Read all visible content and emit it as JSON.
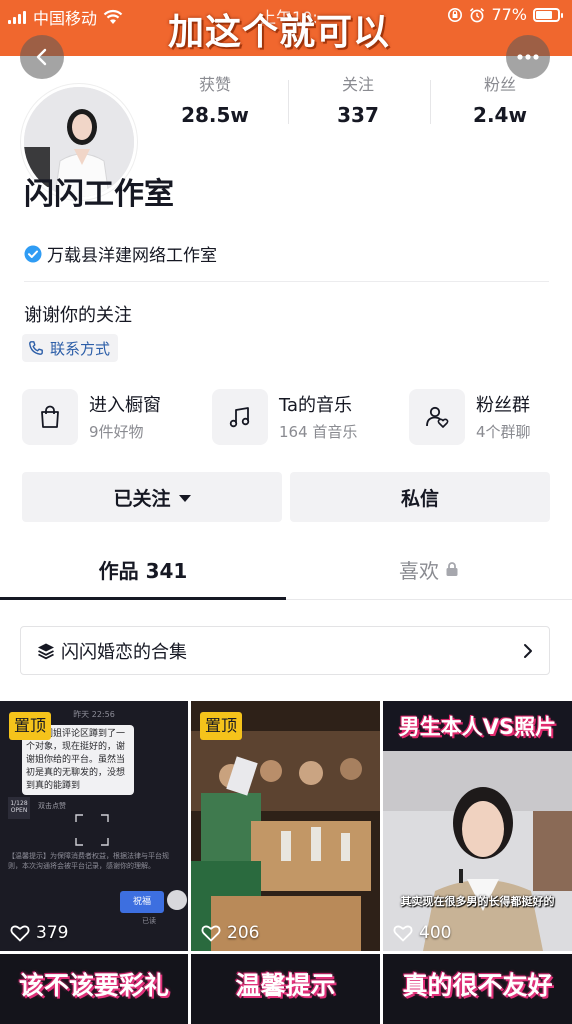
{
  "overlay_caption": "加这个就可以",
  "status_bar": {
    "carrier": "中国移动",
    "clock_partial": "上午10:",
    "battery_percent": "77%",
    "battery_level": 0.77
  },
  "profile": {
    "stats": [
      {
        "label": "获赞",
        "value": "28.5w"
      },
      {
        "label": "关注",
        "value": "337"
      },
      {
        "label": "粉丝",
        "value": "2.4w"
      }
    ],
    "nickname": "闪闪工作室",
    "verification": "万载县洋建网络工作室",
    "bio": "谢谢你的关注",
    "contact_label": "联系方式"
  },
  "features": [
    {
      "icon": "shopping-bag-icon",
      "title": "进入橱窗",
      "subtitle": "9件好物"
    },
    {
      "icon": "music-note-icon",
      "title": "Ta的音乐",
      "subtitle": "164 首音乐"
    },
    {
      "icon": "fan-group-icon",
      "title": "粉丝群",
      "subtitle": "4个群聊"
    }
  ],
  "actions": {
    "followed_label": "已关注",
    "message_label": "私信"
  },
  "tabs": {
    "works_label": "作品 341",
    "likes_label": "喜欢"
  },
  "collection": {
    "label": "闪闪婚恋的合集"
  },
  "videos": [
    {
      "pinned_label": "置顶",
      "likes": "379"
    },
    {
      "pinned_label": "置顶",
      "likes": "206"
    },
    {
      "title": "男生本人VS照片",
      "caption": "其实现在很多男的长得都挺好的",
      "likes": "400"
    },
    {
      "title": "该不该要彩礼"
    },
    {
      "title": "温馨提示"
    },
    {
      "title": "真的很不友好"
    }
  ],
  "video1_chat": {
    "time": "昨天 22:56",
    "message": "在闪闪姐评论区蹲到了一个对象，现在挺好的，谢谢姐你给的平台。虽然当初是真的无聊发的，没想到真的能蹲到",
    "badge": "1/128",
    "badge_sub": "OPEN",
    "scan_hint": "双击点赞",
    "notice": "【温馨提示】为保障消费者权益，根据法律与平台规则，本次沟通将会被平台记录，感谢你的理解。",
    "reply_button": "祝福",
    "read": "已读"
  },
  "colors": {
    "accent_orange": "#f0672e",
    "pin_yellow": "#f5c31b",
    "link_blue": "#2c5ea8",
    "verify_blue": "#2f9cf4"
  }
}
